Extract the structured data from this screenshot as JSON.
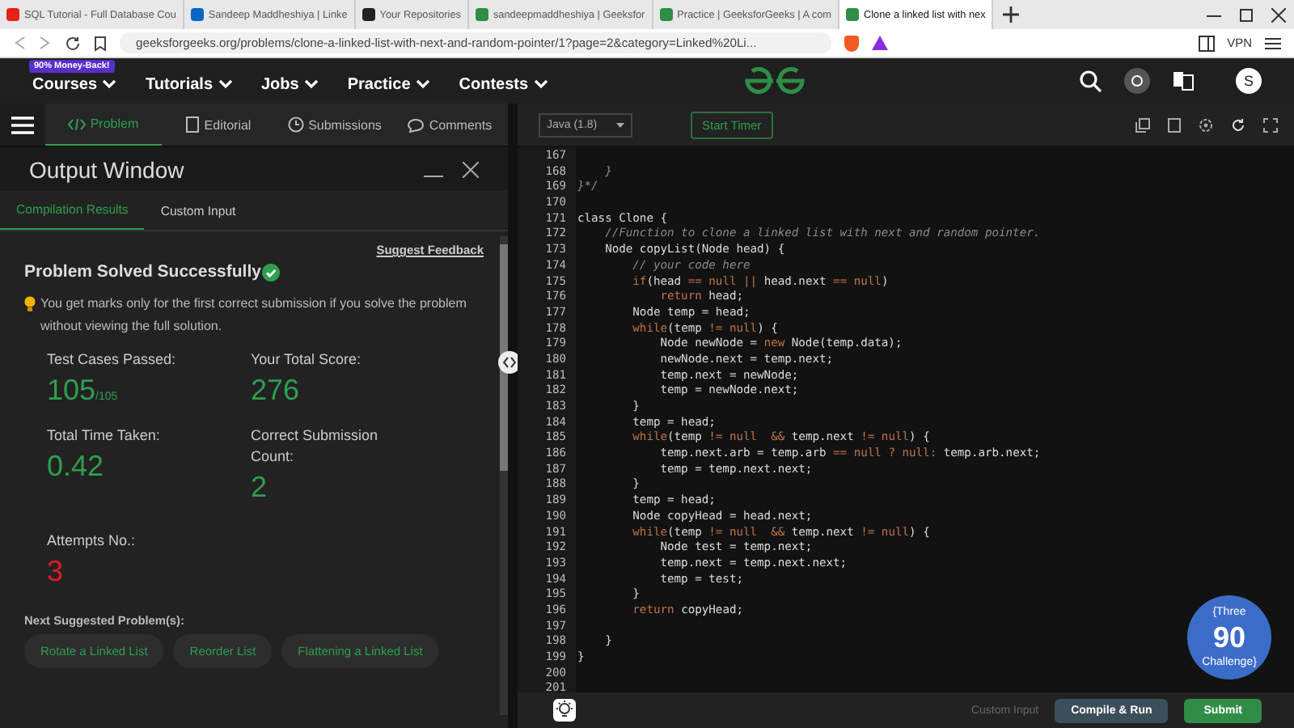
{
  "browser_tabs": [
    {
      "label": "SQL Tutorial - Full Database Cou",
      "kind": "video",
      "selected": false
    },
    {
      "label": "Sandeep Maddheshiya | Linke",
      "kind": "in",
      "selected": false
    },
    {
      "label": "Your Repositories",
      "kind": "cat",
      "selected": false
    },
    {
      "label": "sandeepmaddheshiya | Geeksfor",
      "kind": "gg",
      "selected": false
    },
    {
      "label": "Practice | GeeksforGeeks | A com",
      "kind": "gg",
      "selected": false
    },
    {
      "label": "Clone a linked list with nex",
      "kind": "gg",
      "selected": true
    }
  ],
  "address_bar": {
    "url": "geeksforgeeks.org/problems/clone-a-linked-list-with-next-and-random-pointer/1?page=2&category=Linked%20Li...",
    "vpn": "VPN"
  },
  "site_nav": {
    "badge": "90% Money-Back!",
    "items": [
      "Courses",
      "Tutorials",
      "Jobs",
      "Practice",
      "Contests"
    ],
    "avatar": "S"
  },
  "problem_tabs": [
    {
      "label": "Problem",
      "kind": "code",
      "selected": true
    },
    {
      "label": "Editorial",
      "kind": "doc",
      "selected": false
    },
    {
      "label": "Submissions",
      "kind": "clock",
      "selected": false
    },
    {
      "label": "Comments",
      "kind": "chat",
      "selected": false
    }
  ],
  "output_window": {
    "title": "Output Window",
    "tabs": [
      {
        "label": "Compilation Results",
        "selected": true
      },
      {
        "label": "Custom Input",
        "selected": false
      }
    ],
    "feedback_link": "Suggest Feedback",
    "status": "Problem Solved Successfully",
    "note": "You get marks only for the first correct submission if you solve the problem without viewing the full solution.",
    "stats": [
      {
        "label": "Test Cases Passed:",
        "value": "105",
        "suffix": "/105",
        "color": "#2f9e4f"
      },
      {
        "label": "Your Total Score:",
        "value": "276",
        "color": "#2f9e4f"
      },
      {
        "label": "Total Time Taken:",
        "value": "0.42",
        "color": "#2f9e4f"
      },
      {
        "label": "Correct Submission Count:",
        "value": "2",
        "color": "#2f9e4f"
      },
      {
        "label": "Attempts No.:",
        "value": "3",
        "color": "#e0192b"
      }
    ],
    "suggested_heading": "Next Suggested Problem(s):",
    "suggested": [
      "Rotate a Linked List",
      "Reorder List",
      "Flattening a Linked List"
    ]
  },
  "editor": {
    "language": "Java (1.8)",
    "timer": "Start Timer",
    "lines": [
      {
        "number": "167"
      },
      {
        "number": "168",
        "parts": [
          {
            "kind": "c",
            "t": "    }"
          }
        ]
      },
      {
        "number": "169",
        "parts": [
          {
            "kind": "c",
            "t": "}*/"
          }
        ]
      },
      {
        "number": "170"
      },
      {
        "number": "171",
        "parts": [
          {
            "kind": "p",
            "t": "class Clone {"
          }
        ]
      },
      {
        "number": "172",
        "parts": [
          {
            "kind": "c",
            "t": "    //Function to clone a linked list with next and random pointer."
          }
        ]
      },
      {
        "number": "173",
        "parts": [
          {
            "kind": "p",
            "t": "    Node copyList(Node head) {"
          }
        ]
      },
      {
        "number": "174",
        "parts": [
          {
            "kind": "c",
            "t": "        // your code here"
          }
        ]
      },
      {
        "number": "175",
        "parts": [
          {
            "kind": "w",
            "t": "        if"
          },
          {
            "kind": "p",
            "t": "(head "
          },
          {
            "kind": "w",
            "t": "== null || "
          },
          {
            "kind": "p",
            "t": "head.next "
          },
          {
            "kind": "w",
            "t": "== null"
          },
          {
            "kind": "p",
            "t": ")"
          }
        ]
      },
      {
        "number": "176",
        "parts": [
          {
            "kind": "w",
            "t": "            return"
          },
          {
            "kind": "p",
            "t": " head;"
          }
        ]
      },
      {
        "number": "177",
        "parts": [
          {
            "kind": "p",
            "t": "        Node temp = head;"
          }
        ]
      },
      {
        "number": "178",
        "parts": [
          {
            "kind": "w",
            "t": "        while"
          },
          {
            "kind": "p",
            "t": "(temp "
          },
          {
            "kind": "w",
            "t": "!= null"
          },
          {
            "kind": "p",
            "t": ") {"
          }
        ]
      },
      {
        "number": "179",
        "parts": [
          {
            "kind": "p",
            "t": "            Node newNode = "
          },
          {
            "kind": "w",
            "t": "new"
          },
          {
            "kind": "p",
            "t": " Node(temp.data);"
          }
        ]
      },
      {
        "number": "180",
        "parts": [
          {
            "kind": "p",
            "t": "            newNode.next = temp.next;"
          }
        ]
      },
      {
        "number": "181",
        "parts": [
          {
            "kind": "p",
            "t": "            temp.next = newNode;"
          }
        ]
      },
      {
        "number": "182",
        "parts": [
          {
            "kind": "p",
            "t": "            temp = newNode.next;"
          }
        ]
      },
      {
        "number": "183",
        "parts": [
          {
            "kind": "p",
            "t": "        }"
          }
        ]
      },
      {
        "number": "184",
        "parts": [
          {
            "kind": "p",
            "t": "        temp = head;"
          }
        ]
      },
      {
        "number": "185",
        "parts": [
          {
            "kind": "w",
            "t": "        while"
          },
          {
            "kind": "p",
            "t": "(temp "
          },
          {
            "kind": "w",
            "t": "!= null  && "
          },
          {
            "kind": "p",
            "t": "temp.next "
          },
          {
            "kind": "w",
            "t": "!= null"
          },
          {
            "kind": "p",
            "t": ") {"
          }
        ]
      },
      {
        "number": "186",
        "parts": [
          {
            "kind": "p",
            "t": "            temp.next.arb = temp.arb "
          },
          {
            "kind": "w",
            "t": "== null ? null:"
          },
          {
            "kind": "p",
            "t": " temp.arb.next;"
          }
        ]
      },
      {
        "number": "187",
        "parts": [
          {
            "kind": "p",
            "t": "            temp = temp.next.next;"
          }
        ]
      },
      {
        "number": "188",
        "parts": [
          {
            "kind": "p",
            "t": "        }"
          }
        ]
      },
      {
        "number": "189",
        "parts": [
          {
            "kind": "p",
            "t": "        temp = head;"
          }
        ]
      },
      {
        "number": "190",
        "parts": [
          {
            "kind": "p",
            "t": "        Node copyHead = head.next;"
          }
        ]
      },
      {
        "number": "191",
        "parts": [
          {
            "kind": "w",
            "t": "        while"
          },
          {
            "kind": "p",
            "t": "(temp "
          },
          {
            "kind": "w",
            "t": "!= null  && "
          },
          {
            "kind": "p",
            "t": "temp.next "
          },
          {
            "kind": "w",
            "t": "!= null"
          },
          {
            "kind": "p",
            "t": ") {"
          }
        ]
      },
      {
        "number": "192",
        "parts": [
          {
            "kind": "p",
            "t": "            Node test = temp.next;"
          }
        ]
      },
      {
        "number": "193",
        "parts": [
          {
            "kind": "p",
            "t": "            temp.next = temp.next.next;"
          }
        ]
      },
      {
        "number": "194",
        "parts": [
          {
            "kind": "p",
            "t": "            temp = test;"
          }
        ]
      },
      {
        "number": "195",
        "parts": [
          {
            "kind": "p",
            "t": "        }"
          }
        ]
      },
      {
        "number": "196",
        "parts": [
          {
            "kind": "w",
            "t": "        return"
          },
          {
            "kind": "p",
            "t": " copyHead;"
          }
        ]
      },
      {
        "number": "197"
      },
      {
        "number": "198",
        "parts": [
          {
            "kind": "p",
            "t": "    }"
          }
        ]
      },
      {
        "number": "199",
        "parts": [
          {
            "kind": "p",
            "t": "}"
          }
        ]
      },
      {
        "number": "200"
      },
      {
        "number": "201"
      }
    ],
    "challenge_badge": [
      "{Three",
      "90",
      "Challenge}"
    ],
    "custom_input": "Custom Input",
    "compile_button": "Compile & Run",
    "submit_button": "Submit"
  }
}
